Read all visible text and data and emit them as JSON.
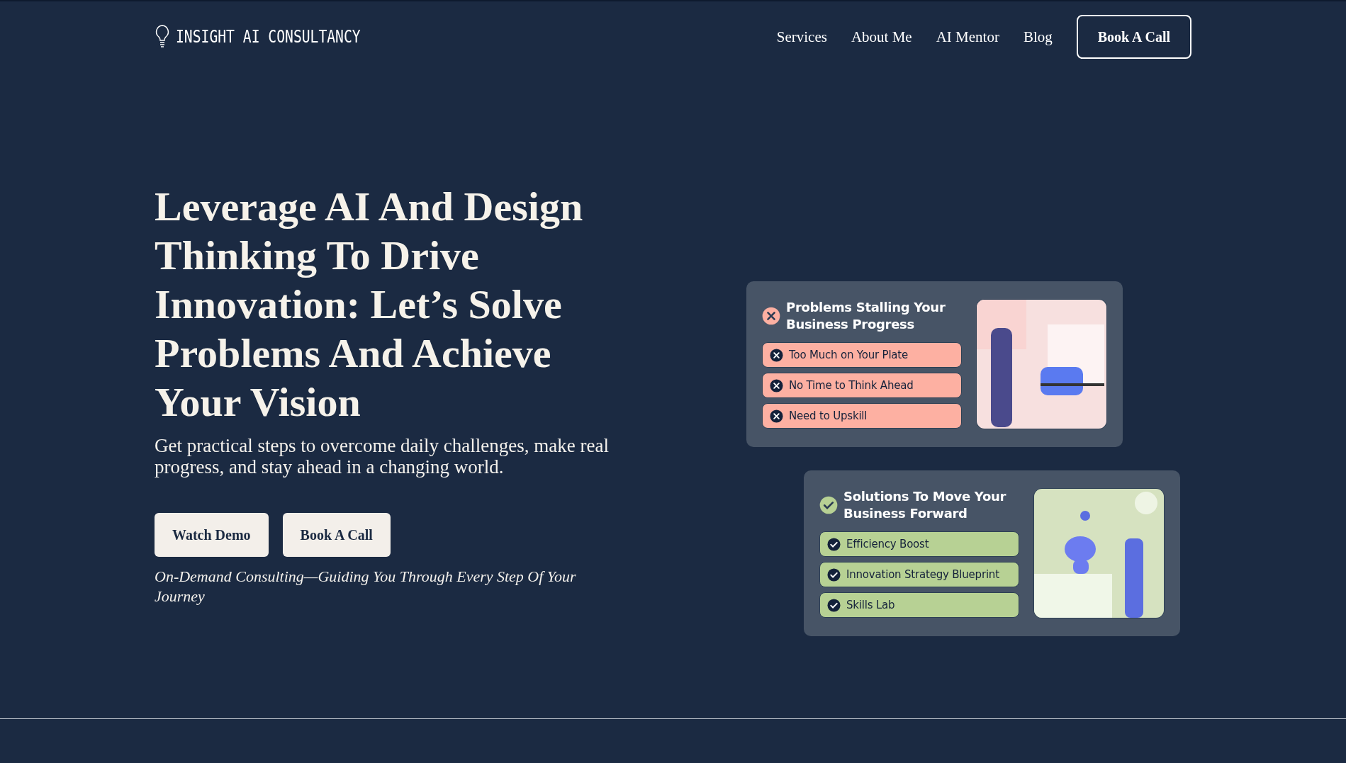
{
  "header": {
    "logo": "INSIGHT AI CONSULTANCY",
    "nav": [
      "Services",
      "About Me",
      "AI Mentor",
      "Blog"
    ],
    "cta": "Book A Call"
  },
  "hero": {
    "heading": "Leverage AI And Design Thinking To Drive Innovation: Let’s Solve Problems And Achieve Your Vision",
    "subheading": "Get practical steps to overcome daily challenges, make real progress, and stay ahead in a changing world.",
    "buttons": [
      "Watch Demo",
      "Book A Call"
    ],
    "tagline": "On-Demand Consulting—Guiding You Through Every Step Of Your Journey"
  },
  "cards": [
    {
      "kind": "problem",
      "title": "Problems Stalling Your Business Progress",
      "items": [
        "Too Much on Your Plate",
        "No Time to Think Ahead",
        "Need to Upskill"
      ]
    },
    {
      "kind": "solution",
      "title": "Solutions To Move Your Business Forward",
      "items": [
        "Efficiency Boost",
        "Innovation Strategy Blueprint",
        "Skills Lab"
      ]
    }
  ]
}
